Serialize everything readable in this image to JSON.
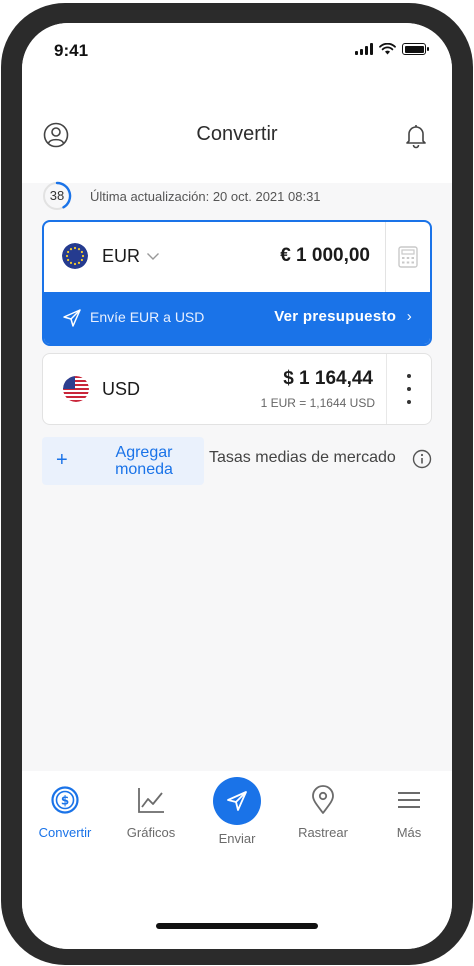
{
  "status": {
    "time": "9:41"
  },
  "header": {
    "title": "Convertir"
  },
  "update": {
    "timer": "38",
    "text": "Última actualización: 20 oct. 2021 08:31"
  },
  "base": {
    "code": "EUR",
    "amount": "€ 1 000,00",
    "send_text": "Envíe EUR a USD",
    "budget_link": "Ver presupuesto"
  },
  "target": {
    "code": "USD",
    "amount": "$ 1 164,44",
    "rate": "1 EUR = 1,1644 USD"
  },
  "add": {
    "label": "Agregar moneda",
    "market_text": "Tasas medias de mercado"
  },
  "tabs": [
    {
      "label": "Convertir",
      "icon": "dollar-circle-icon",
      "active": true
    },
    {
      "label": "Gráficos",
      "icon": "chart-icon",
      "active": false
    },
    {
      "label": "Enviar",
      "icon": "send-icon",
      "active": false
    },
    {
      "label": "Rastrear",
      "icon": "location-pin-icon",
      "active": false
    },
    {
      "label": "Más",
      "icon": "menu-icon",
      "active": false
    }
  ],
  "colors": {
    "accent": "#1a73e8",
    "frame": "#2b2b2b",
    "background": "#f7f7f8"
  }
}
